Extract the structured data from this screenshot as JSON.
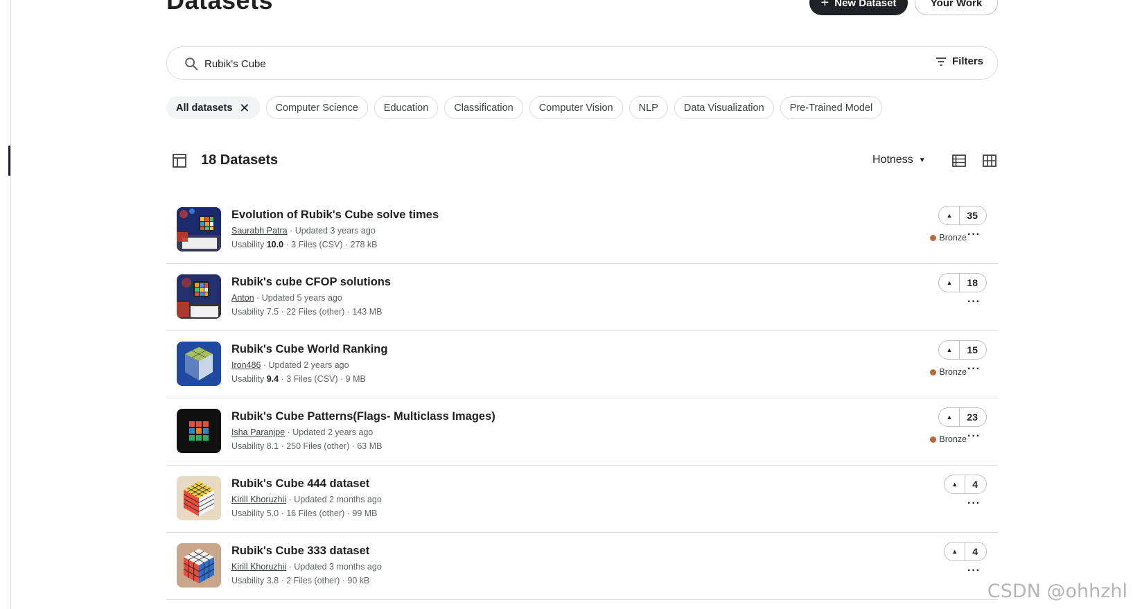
{
  "page": {
    "title": "Datasets"
  },
  "header": {
    "new_dataset_label": "New Dataset",
    "your_work_label": "Your Work"
  },
  "search": {
    "value": "Rubik's Cube",
    "filters_label": "Filters"
  },
  "chips": [
    {
      "label": "All datasets",
      "active": true
    },
    {
      "label": "Computer Science"
    },
    {
      "label": "Education"
    },
    {
      "label": "Classification"
    },
    {
      "label": "Computer Vision"
    },
    {
      "label": "NLP"
    },
    {
      "label": "Data Visualization"
    },
    {
      "label": "Pre-Trained Model"
    }
  ],
  "results": {
    "count_label": "18 Datasets",
    "sort_label": "Hotness"
  },
  "datasets": [
    {
      "title": "Evolution of Rubik's Cube solve times",
      "author": "Saurabh Patra",
      "updated": " · Updated 3 years ago",
      "usability_prefix": "Usability ",
      "usability": "10.0",
      "usability_bold": true,
      "files": " · 3 Files (CSV) · 278 kB",
      "votes": "35",
      "medal": "Bronze"
    },
    {
      "title": "Rubik's cube CFOP solutions",
      "author": "Anton",
      "updated": " · Updated 5 years ago",
      "usability_prefix": "Usability ",
      "usability": "7.5",
      "usability_bold": false,
      "files": " · 22 Files (other) · 143 MB",
      "votes": "18",
      "medal": ""
    },
    {
      "title": "Rubik's Cube World Ranking",
      "author": "Iron486",
      "updated": " · Updated 2 years ago",
      "usability_prefix": "Usability ",
      "usability": "9.4",
      "usability_bold": true,
      "files": " · 3 Files (CSV) · 9 MB",
      "votes": "15",
      "medal": "Bronze"
    },
    {
      "title": "Rubik's Cube Patterns(Flags- Multiclass Images)",
      "author": "Isha Paranjpe",
      "updated": " · Updated 2 years ago",
      "usability_prefix": "Usability ",
      "usability": "8.1",
      "usability_bold": false,
      "files": " · 250 Files (other) · 63 MB",
      "votes": "23",
      "medal": "Bronze"
    },
    {
      "title": "Rubik's Cube 444 dataset",
      "author": "Kirill Khoruzhii",
      "updated": " · Updated 2 months ago",
      "usability_prefix": "Usability ",
      "usability": "5.0",
      "usability_bold": false,
      "files": " · 16 Files (other) · 99 MB",
      "votes": "4",
      "medal": ""
    },
    {
      "title": "Rubik's Cube 333 dataset",
      "author": "Kirill Khoruzhii",
      "updated": " · Updated 3 months ago",
      "usability_prefix": "Usability ",
      "usability": "3.8",
      "usability_bold": false,
      "files": " · 2 Files (other) · 90 kB",
      "votes": "4",
      "medal": ""
    }
  ],
  "icons": {
    "more": "more-horiz-icon",
    "upvote": "upvote-arrow-icon",
    "medal": "bronze-medal-icon"
  },
  "watermark": "CSDN @ohhzhl"
}
